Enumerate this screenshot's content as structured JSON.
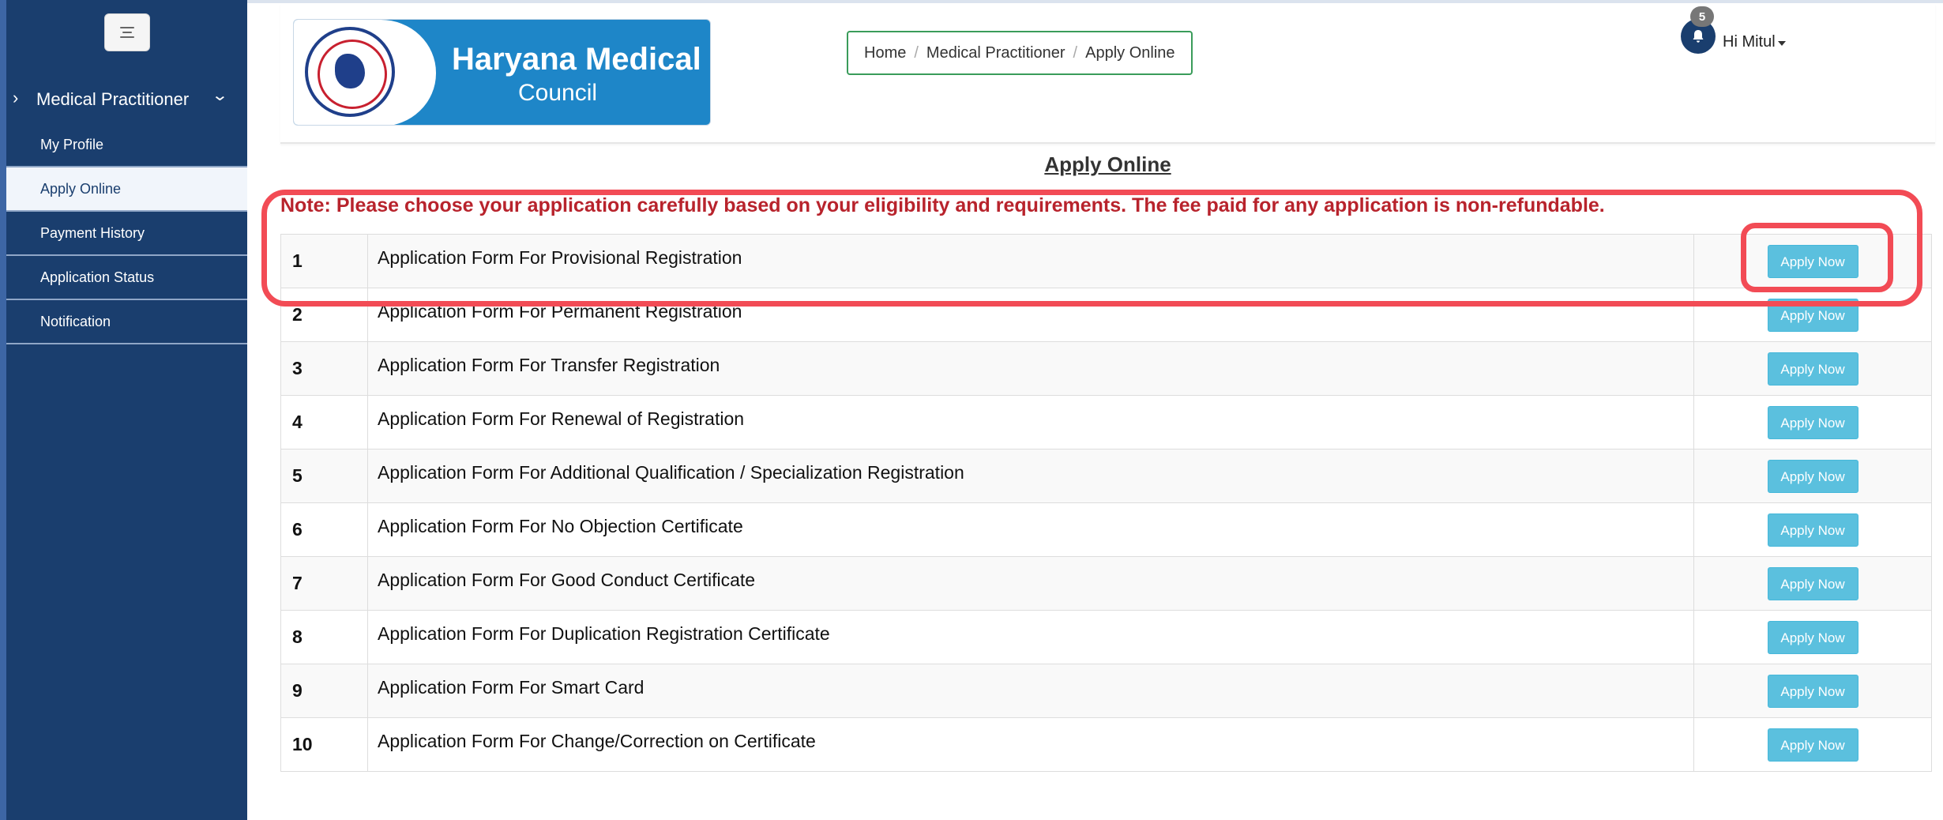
{
  "sidebar": {
    "group_label": "Medical Practitioner",
    "items": [
      {
        "label": "My Profile",
        "active": false
      },
      {
        "label": "Apply Online",
        "active": true
      },
      {
        "label": "Payment History",
        "active": false
      },
      {
        "label": "Application Status",
        "active": false
      },
      {
        "label": "Notification",
        "active": false
      }
    ]
  },
  "header": {
    "logo_line1": "Haryana Medical",
    "logo_line2": "Council",
    "breadcrumb": [
      "Home",
      "Medical Practitioner",
      "Apply Online"
    ],
    "notification_count": "5",
    "user_greeting": "Hi Mitul"
  },
  "main": {
    "title": "Apply Online",
    "note": "Note: Please choose your application carefully based on your eligibility and requirements. The fee paid for any application is non-refundable.",
    "button_label": "Apply Now",
    "applications": [
      {
        "num": "1",
        "name": "Application Form For Provisional Registration"
      },
      {
        "num": "2",
        "name": "Application Form For Permanent Registration"
      },
      {
        "num": "3",
        "name": "Application Form For Transfer Registration"
      },
      {
        "num": "4",
        "name": "Application Form For Renewal of Registration"
      },
      {
        "num": "5",
        "name": "Application Form For Additional Qualification / Specialization Registration"
      },
      {
        "num": "6",
        "name": "Application Form For No Objection Certificate"
      },
      {
        "num": "7",
        "name": "Application Form For Good Conduct Certificate"
      },
      {
        "num": "8",
        "name": "Application Form For Duplication Registration Certificate"
      },
      {
        "num": "9",
        "name": "Application Form For Smart Card"
      },
      {
        "num": "10",
        "name": "Application Form For Change/Correction on Certificate"
      }
    ]
  },
  "colors": {
    "sidebar_bg": "#1a3e6e",
    "button_bg": "#5bc0de",
    "note_text": "#b8232c",
    "highlight": "#f24b55"
  }
}
